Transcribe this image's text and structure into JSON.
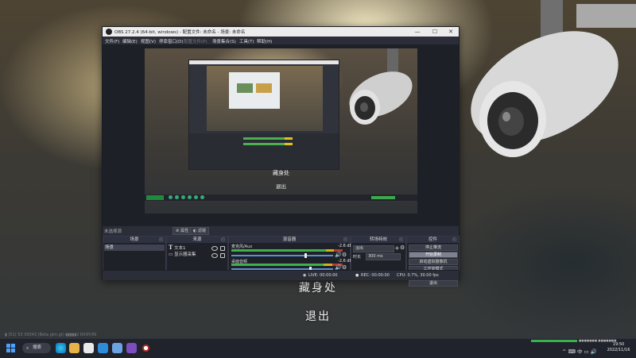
{
  "window": {
    "title": "OBS 27.2.4 (64-bit, windows) - 配置文件: 未命名 - 场景: 未命名",
    "controls": {
      "minimize": "—",
      "maximize": "☐",
      "close": "✕"
    }
  },
  "menu": [
    "文件(F)",
    "编辑(E)",
    "视图(V)",
    "停靠窗口(D)",
    "配置文件(P)",
    "场景集合(S)",
    "工具(T)",
    "帮助(H)"
  ],
  "preview": {
    "title_text": "藏身处",
    "exit_text": "退出"
  },
  "context_bar": {
    "no_source": "未选择源",
    "properties": "属性",
    "filters": "滤镜"
  },
  "docks": {
    "scenes": {
      "title": "场景",
      "items": [
        "场景"
      ]
    },
    "sources": {
      "title": "来源",
      "items": [
        "文本1",
        "显示器采集"
      ]
    },
    "mixer": {
      "title": "混音器",
      "channels": [
        {
          "name": "麦克风/Aux",
          "db": "-2.6 dB",
          "level": 0.92
        },
        {
          "name": "桌面音频",
          "db": "-2.6 dB",
          "level": 0.9
        }
      ]
    },
    "transitions": {
      "title": "转场特效",
      "type": "淡出",
      "duration_label": "时长",
      "duration_value": "300 ms"
    },
    "controls": {
      "title": "控件",
      "buttons": [
        "停止推流",
        "开始录制",
        "启动虚拟摄像机",
        "工作室模式",
        "设置",
        "退出"
      ],
      "active_index": 1
    }
  },
  "status": {
    "live": "LIVE: 00:00:00",
    "rec": "REC: 00:00:00",
    "cpu": "CPU: 0.7%, 30.00 fps"
  },
  "desktop": {
    "title_text": "藏身处",
    "exit_text": "退出",
    "url_fragment": "▮ (51) 53 39343 (Beta gim.gt) ▮▮▮▮▮2 RX9Y/IN"
  },
  "taskbar": {
    "search": "搜索",
    "tray_text": "■■■■■■■ ■■■■■■■",
    "tray_icons": "^ ⌨ 中 ▭ 🔊",
    "time": "19:50",
    "date": "2022/11/16"
  },
  "colors": {
    "accent": "#4aa3ff",
    "meter_green": "#3fb04a",
    "meter_yellow": "#cdb51c",
    "meter_red": "#b83a2e"
  }
}
